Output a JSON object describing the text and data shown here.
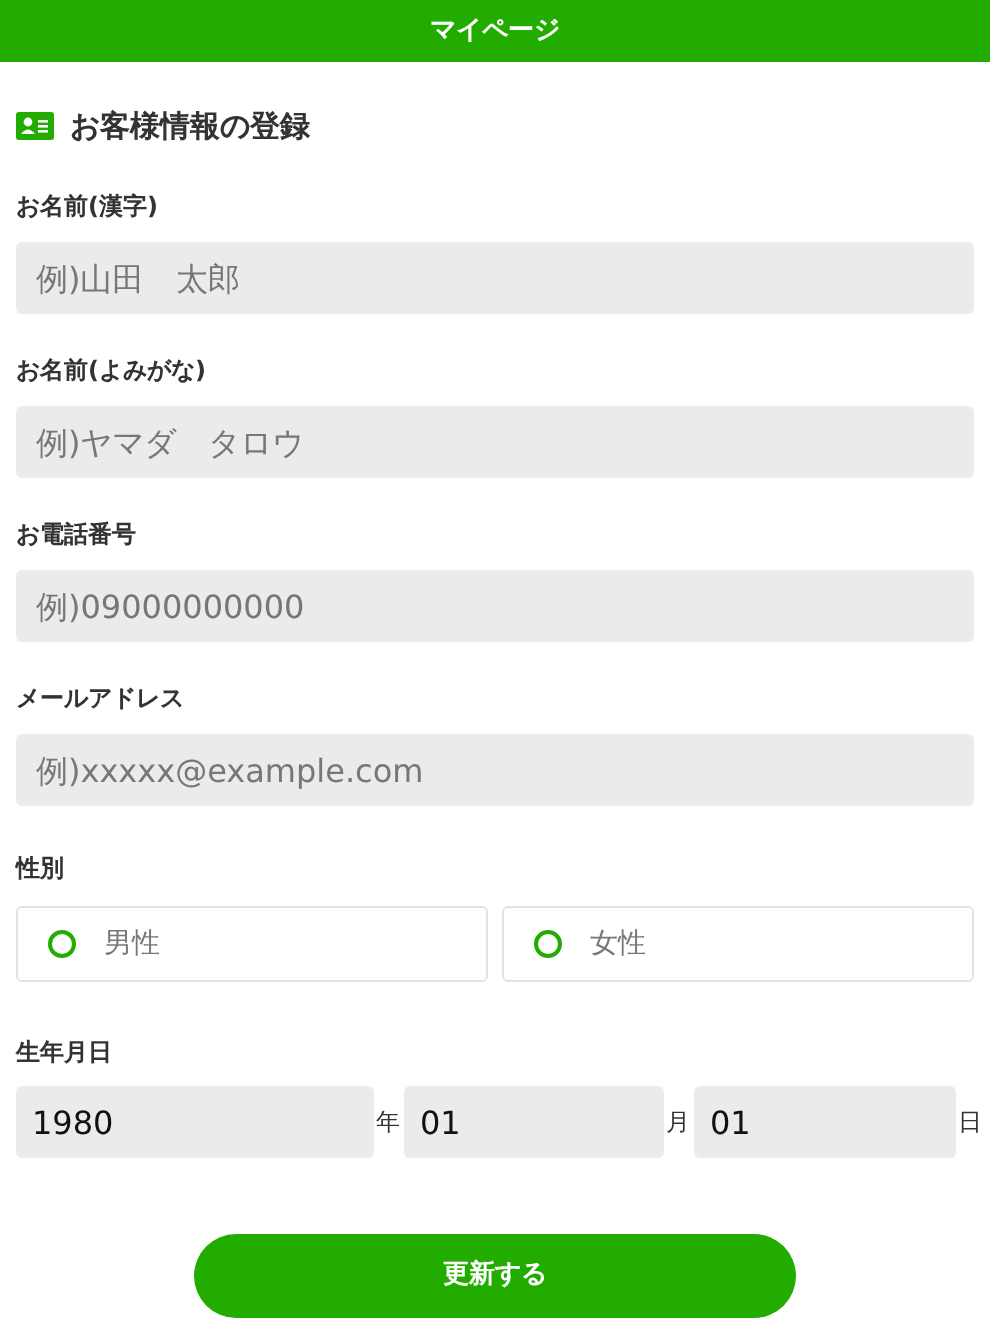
{
  "header": {
    "title": "マイページ"
  },
  "heading": "お客様情報の登録",
  "fields": [
    {
      "label": "お名前(漢字)",
      "placeholder": "例)山田　太郎"
    },
    {
      "label": "お名前(よみがな)",
      "placeholder": "例)ヤマダ　タロウ"
    },
    {
      "label": "お電話番号",
      "placeholder": "例)09000000000"
    },
    {
      "label": "メールアドレス",
      "placeholder": "例)xxxxx@example.com"
    }
  ],
  "gender": {
    "label": "性別",
    "options": [
      {
        "label": "男性",
        "selected": false
      },
      {
        "label": "女性",
        "selected": false
      }
    ]
  },
  "birthday": {
    "label": "生年月日",
    "parts": [
      {
        "value": "1980",
        "unit": "年"
      },
      {
        "value": "01",
        "unit": "月"
      },
      {
        "value": "01",
        "unit": "日"
      }
    ]
  },
  "submit": "更新する"
}
